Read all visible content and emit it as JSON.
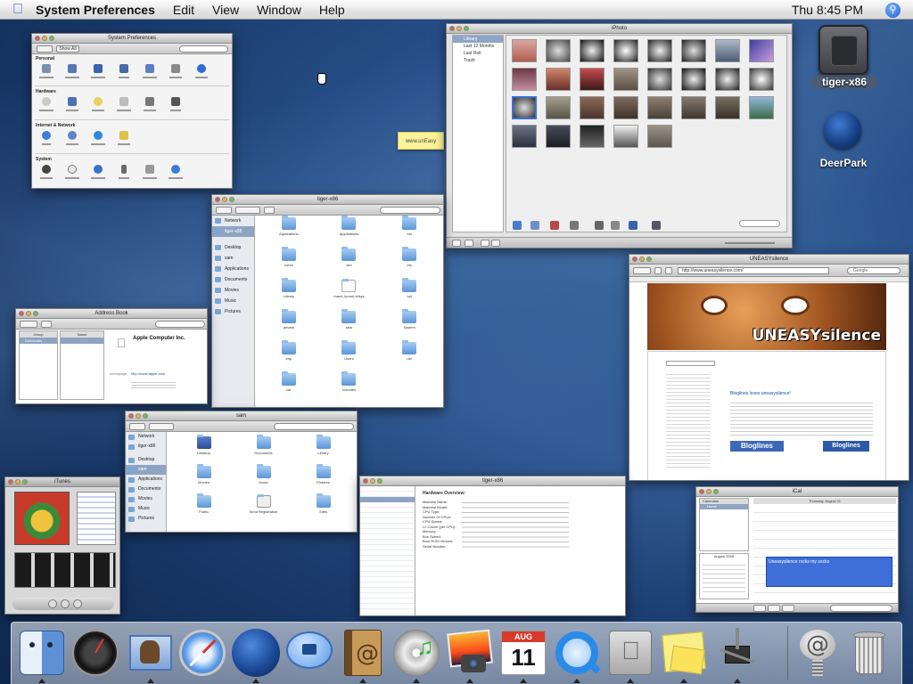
{
  "menubar": {
    "app_name": "System Preferences",
    "items": [
      "Edit",
      "View",
      "Window",
      "Help"
    ],
    "clock": "Thu 8:45 PM"
  },
  "desktop": {
    "drive_label": "tiger-x86",
    "deerpark_label": "DeerPark",
    "sticky_note": "www.unEasy"
  },
  "sysprefs": {
    "title": "System Preferences",
    "show_all": "Show All",
    "sections": [
      "Personal",
      "Hardware",
      "Internet & Network",
      "System"
    ]
  },
  "finder_main": {
    "title": "tiger-x86",
    "sidebar": [
      "Network",
      "tiger-x86",
      "Desktop",
      "sam",
      "Applications",
      "Documents",
      "Movies",
      "Music",
      "Pictures"
    ],
    "items": [
      "Applications",
      "Applications",
      "bin",
      "cores",
      "dev",
      "etc",
      "Library",
      "mach_kernel.ctfsys",
      "opt",
      "private",
      "sbin",
      "System",
      "tmp",
      "Users",
      "usr",
      "var",
      "Volumes"
    ]
  },
  "address_book": {
    "title": "Address Book",
    "col1": "Group",
    "col2": "Name",
    "group": "Directories",
    "card_name": "Apple Computer Inc.",
    "url_label": "homepage",
    "url": "http://www.apple.com"
  },
  "finder_home": {
    "title": "sam",
    "sidebar": [
      "Network",
      "tiger-x86",
      "Desktop",
      "sam",
      "Applications",
      "Documents",
      "Movies",
      "Music",
      "Pictures"
    ],
    "items": [
      "Desktop",
      "Documents",
      "Library",
      "Movies",
      "Music",
      "Pictures",
      "Public",
      "Send Registration",
      "Sites"
    ]
  },
  "iphoto": {
    "title": "iPhoto",
    "sources": [
      "Library",
      "Last 12 Months",
      "Last Roll",
      "Trash"
    ]
  },
  "browser": {
    "title": "UNEASYsilence",
    "url": "http://www.uneasysilence.com/",
    "search": "Google",
    "banner": "UNEASYsilence",
    "bloglines": "Bloglines",
    "headline": "Bloglines loves uneasysilence!"
  },
  "itunes": {
    "title": "iTunes"
  },
  "sysprofiler": {
    "title": "tiger-x86",
    "header": "Hardware Overview:",
    "fields": [
      "Machine Name:",
      "Machine Model:",
      "CPU Type:",
      "Number Of CPUs:",
      "CPU Speed:",
      "L2 Cache (per CPU):",
      "Memory:",
      "Bus Speed:",
      "Boot ROM Version:",
      "Serial Number:"
    ]
  },
  "ical": {
    "title": "iCal",
    "calendars_header": "Calendars",
    "calendar": "Home",
    "month": "August 2005",
    "day_header": "Thursday, August 11",
    "event": "Uneasysilence rocks my socks"
  },
  "dock": {
    "apps": [
      "Finder",
      "Dashboard",
      "Mail",
      "Safari",
      "DeerPark",
      "iChat",
      "Address Book",
      "iTunes",
      "iPhoto",
      "iCal",
      "QuickTime Player",
      "System Preferences",
      "Stickies",
      "System Profiler",
      "Mail Settings",
      "Trash"
    ],
    "ical_month": "AUG",
    "ical_day": "11"
  }
}
